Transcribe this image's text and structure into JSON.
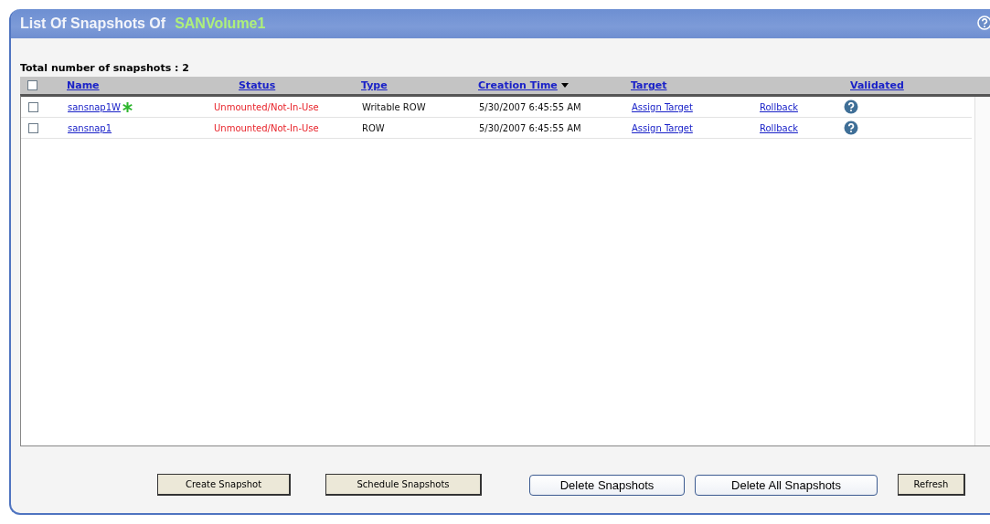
{
  "panel": {
    "title": "List Of Snapshots Of",
    "volume": "SANVolume1"
  },
  "summary": "Total number of snapshots : 2",
  "table": {
    "select_all": {
      "checked": false
    },
    "columns": [
      {
        "label": "Name",
        "sorted": false
      },
      {
        "label": "Status",
        "sorted": false
      },
      {
        "label": "Type",
        "sorted": false
      },
      {
        "label": "Creation Time",
        "sorted": true
      },
      {
        "label": "Target",
        "sorted": false
      },
      {
        "label": "Validated",
        "sorted": false
      }
    ],
    "rows": [
      {
        "checked": false,
        "name": "sansnap1W",
        "starred": true,
        "status": "Unmounted/Not-In-Use",
        "type": "Writable ROW",
        "created": "5/30/2007 6:45:55 AM",
        "target": "Assign Target",
        "action": "Rollback"
      },
      {
        "checked": false,
        "name": "sansnap1",
        "starred": false,
        "status": "Unmounted/Not-In-Use",
        "type": "ROW",
        "created": "5/30/2007 6:45:55 AM",
        "target": "Assign Target",
        "action": "Rollback"
      }
    ]
  },
  "buttons": [
    {
      "label": "Create Snapshot",
      "kind": "classic"
    },
    {
      "label": "Schedule Snapshots",
      "kind": "classic"
    },
    {
      "label": "Delete Snapshots",
      "kind": "rounded"
    },
    {
      "label": "Delete All Snapshots",
      "kind": "rounded"
    },
    {
      "label": "Refresh",
      "kind": "classic"
    }
  ]
}
